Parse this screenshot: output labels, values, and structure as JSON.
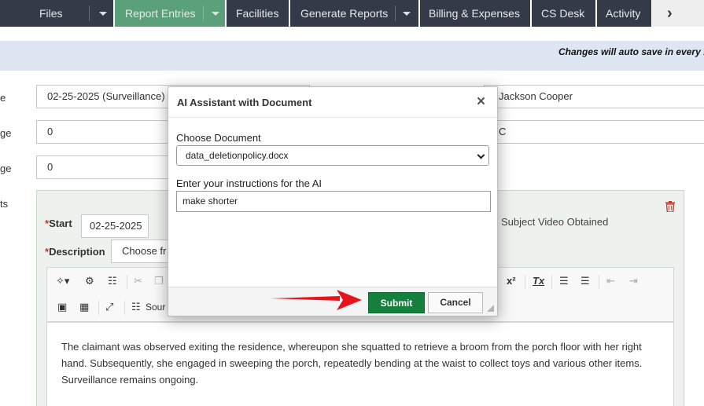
{
  "nav": {
    "items": [
      {
        "label": "Files",
        "active": false,
        "dropdown": true
      },
      {
        "label": "Report Entries",
        "active": true,
        "dropdown": true
      },
      {
        "label": "Facilities",
        "active": false,
        "dropdown": false
      },
      {
        "label": "Generate Reports",
        "active": false,
        "dropdown": true
      },
      {
        "label": "Billing & Expenses",
        "active": false,
        "dropdown": false
      },
      {
        "label": "CS Desk",
        "active": false,
        "dropdown": false
      },
      {
        "label": "Activity",
        "active": false,
        "dropdown": false
      }
    ],
    "more_icon": "chevron-right-icon"
  },
  "banner": {
    "message": "Changes will auto save in every 1"
  },
  "form": {
    "labels": [
      "e",
      "ge",
      "ge",
      "ts"
    ],
    "date_field": "02-25-2025 (Surveillance)",
    "investigator_field": "Jackson Cooper",
    "field_two": "0",
    "field_two_right": "C",
    "field_three": "0"
  },
  "entry": {
    "start_label": "Start",
    "start_value": "02-25-2025",
    "description_label": "Description",
    "choose_button": "Choose fr",
    "subject_video": "Subject Video Obtained",
    "toolbar": {
      "source_label": "Sour",
      "superscript": "x²",
      "clear_format": "Tx"
    },
    "body_text": "The claimant was observed exiting the residence, whereupon she squatted to retrieve a broom from the porch floor with her right hand. Subsequently, she engaged in sweeping the porch, repeatedly bending at the waist to collect toys and various other items. Surveillance remains ongoing."
  },
  "modal": {
    "title": "AI Assistant with Document",
    "close_glyph": "×",
    "document_label": "Choose Document",
    "document_value": "data_deletionpolicy.docx",
    "instructions_label": "Enter your instructions for the AI",
    "instructions_value": "make shorter",
    "submit_label": "Submit",
    "cancel_label": "Cancel"
  },
  "colors": {
    "nav_bg": "#343a47",
    "nav_active": "#5aa07a",
    "banner_bg": "#dde6f2",
    "submit_bg": "#15803d",
    "arrow": "#e8141b"
  }
}
